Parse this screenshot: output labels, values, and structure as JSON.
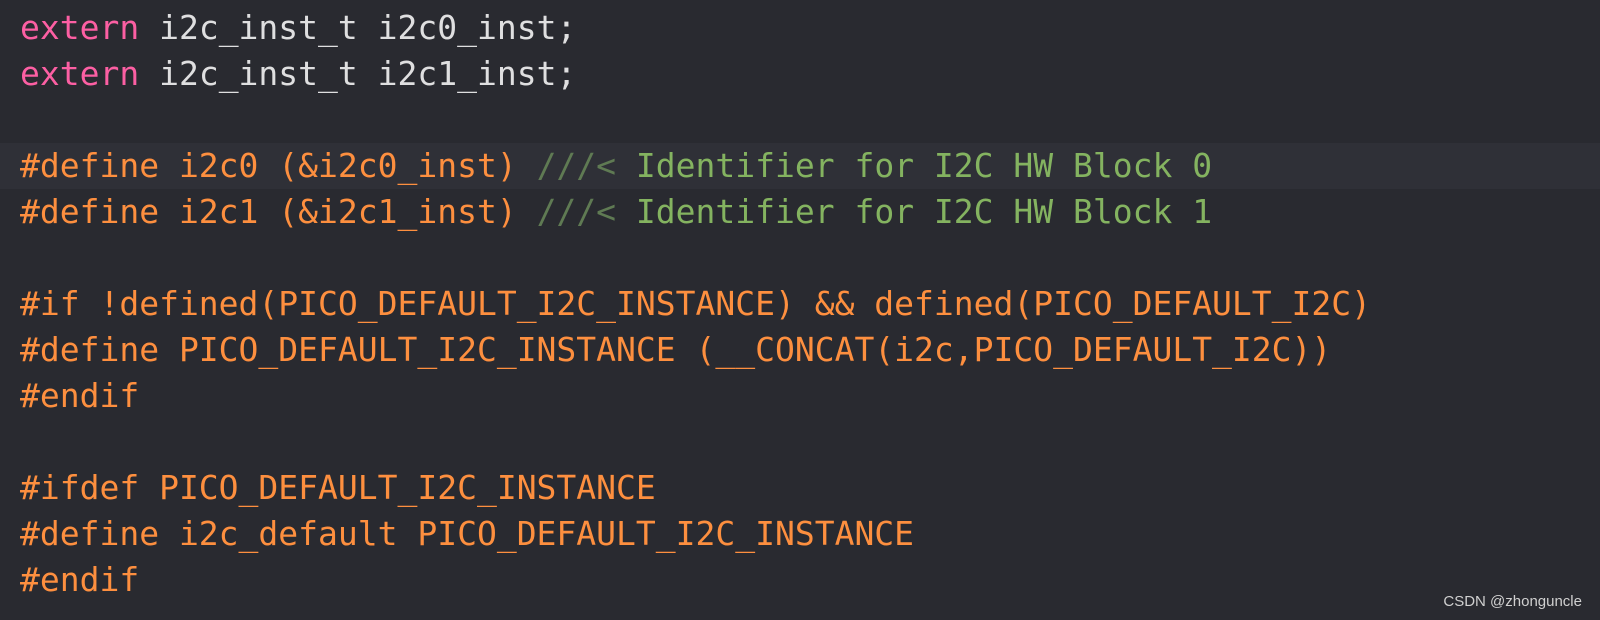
{
  "code": {
    "line1": {
      "keyword": "extern",
      "rest": " i2c_inst_t i2c0_inst;"
    },
    "line2": {
      "keyword": "extern",
      "rest": " i2c_inst_t i2c1_inst;"
    },
    "line4": {
      "directive": "#define i2c0 (&i2c0_inst) ",
      "comment_mark": "///<",
      "comment_text": " Identifier for I2C HW Block 0"
    },
    "line5": {
      "directive": "#define i2c1 (&i2c1_inst) ",
      "comment_mark": "///<",
      "comment_text": " Identifier for I2C HW Block 1"
    },
    "line7": "#if !defined(PICO_DEFAULT_I2C_INSTANCE) && defined(PICO_DEFAULT_I2C)",
    "line8": "#define PICO_DEFAULT_I2C_INSTANCE (__CONCAT(i2c,PICO_DEFAULT_I2C))",
    "line9": "#endif",
    "line11": "#ifdef PICO_DEFAULT_I2C_INSTANCE",
    "line12": "#define i2c_default PICO_DEFAULT_I2C_INSTANCE",
    "line13": "#endif"
  },
  "watermark": "CSDN @zhonguncle",
  "colors": {
    "background": "#292a30",
    "current_line": "#2f3037",
    "keyword": "#fc5fa3",
    "plain_text": "#dfdfe0",
    "preprocessor": "#fd8f3f",
    "doc_comment_marker": "#5f7a53",
    "doc_comment_text": "#84b360"
  }
}
